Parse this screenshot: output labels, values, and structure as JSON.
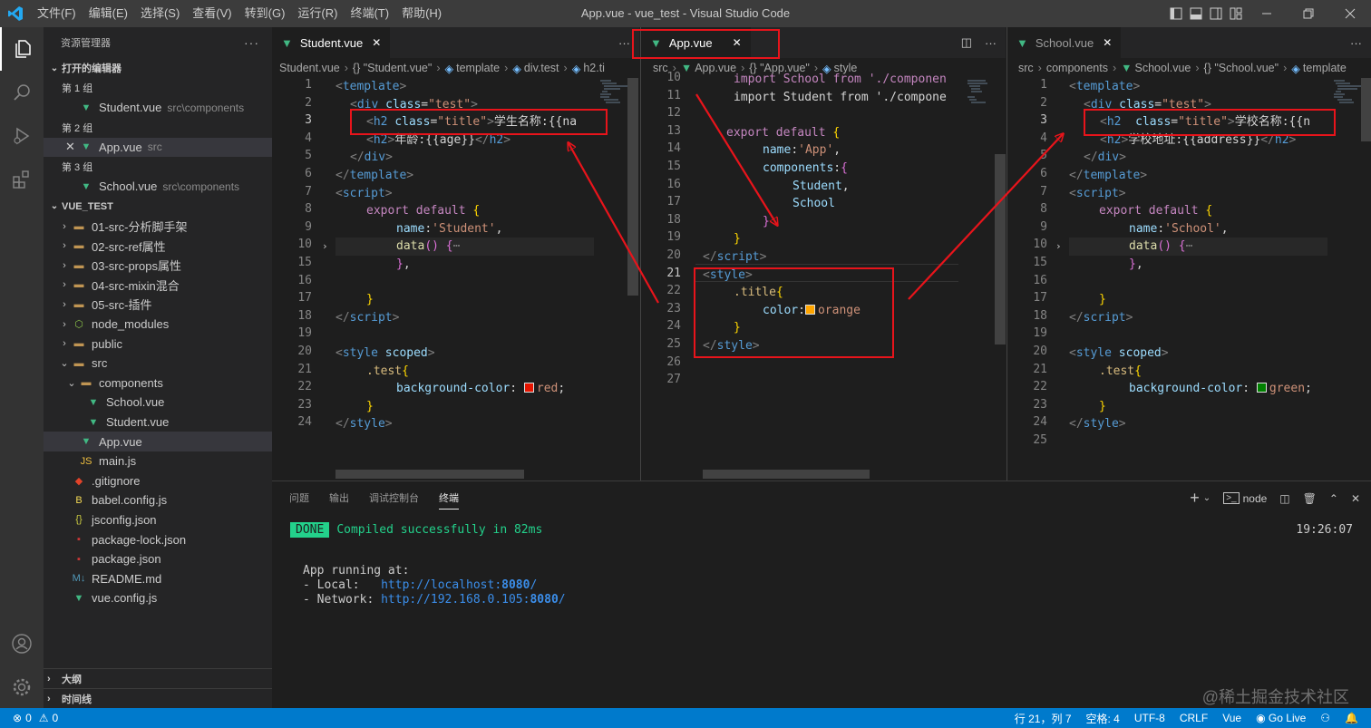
{
  "menu": [
    "文件(F)",
    "编辑(E)",
    "选择(S)",
    "查看(V)",
    "转到(G)",
    "运行(R)",
    "终端(T)",
    "帮助(H)"
  ],
  "window_title": "App.vue - vue_test - Visual Studio Code",
  "explorer": {
    "title": "资源管理器",
    "open_editors": "打开的编辑器",
    "groups": [
      {
        "label": "第 1 组",
        "file": "Student.vue",
        "path": "src\\components"
      },
      {
        "label": "第 2 组",
        "file": "App.vue",
        "path": "src"
      },
      {
        "label": "第 3 组",
        "file": "School.vue",
        "path": "src\\components"
      }
    ],
    "project": "VUE_TEST",
    "folders": [
      "01-src-分析脚手架",
      "02-src-ref属性",
      "03-src-props属性",
      "04-src-mixin混合",
      "05-src-插件",
      "node_modules",
      "public",
      "src"
    ],
    "components_folder": "components",
    "component_files": [
      "School.vue",
      "Student.vue"
    ],
    "src_files": [
      "App.vue",
      "main.js"
    ],
    "root_files": [
      ".gitignore",
      "babel.config.js",
      "jsconfig.json",
      "package-lock.json",
      "package.json",
      "README.md",
      "vue.config.js"
    ],
    "outline": "大纲",
    "timeline": "时间线"
  },
  "editor1": {
    "tab": "Student.vue",
    "crumbs": [
      "Student.vue",
      "{} \"Student.vue\"",
      "template",
      "div.test",
      "h2.ti"
    ],
    "line_numbers": [
      "1",
      "2",
      "3",
      "4",
      "5",
      "6",
      "7",
      "8",
      "9",
      "10",
      "15",
      "16",
      "17",
      "18",
      "19",
      "20",
      "21",
      "22",
      "23",
      "24"
    ]
  },
  "editor2": {
    "tab": "App.vue",
    "crumbs": [
      "src",
      "App.vue",
      "{} \"App.vue\"",
      "style"
    ],
    "line_numbers": [
      "10",
      "11",
      "12",
      "13",
      "14",
      "15",
      "16",
      "17",
      "18",
      "19",
      "20",
      "21",
      "22",
      "23",
      "24",
      "25",
      "26",
      "27"
    ]
  },
  "editor3": {
    "tab": "School.vue",
    "crumbs": [
      "src",
      "components",
      "School.vue",
      "{} \"School.vue\"",
      "template"
    ],
    "line_numbers": [
      "1",
      "2",
      "3",
      "4",
      "5",
      "6",
      "7",
      "8",
      "9",
      "10",
      "15",
      "16",
      "17",
      "18",
      "19",
      "20",
      "21",
      "22",
      "23",
      "24",
      "25"
    ]
  },
  "code": {
    "template_open": "template",
    "div": "div",
    "class_attr": "class",
    "test_val": "\"test\"",
    "title_val": "\"title\"",
    "h2": "h2",
    "student_name": "学生名称:{{na",
    "student_age": "年龄:{{age}}",
    "script": "script",
    "export": "export",
    "default": "default",
    "name_key": "name",
    "student_str": "'Student'",
    "data_fn": "data",
    "ellipsis": "⋯",
    "style": "style",
    "scoped": "scoped",
    "test_sel": ".test",
    "bg_prop": "background-color",
    "red": "red",
    "app_import1": "import School from './componen",
    "app_import2": "import Student from './compone",
    "app_str": "'App'",
    "components_key": "components",
    "student_ref": "Student",
    "school_ref": "School",
    "title_sel": ".title",
    "color_prop": "color",
    "orange": "orange",
    "school_name": "学校名称:{{n",
    "school_addr": "学校地址:{{address}}",
    "school_str": "'School'",
    "green": "green"
  },
  "panel": {
    "tabs": [
      "问题",
      "输出",
      "调试控制台",
      "终端"
    ],
    "terminal_name": "node",
    "done": "DONE",
    "compiled": "Compiled successfully in 82ms",
    "time": "19:26:07",
    "running": "App running at:",
    "local_label": "- Local:   ",
    "local_url_a": "http://localhost:",
    "local_url_b": "8080",
    "local_url_c": "/",
    "network_label": "- Network: ",
    "network_url_a": "http://192.168.0.105:",
    "network_url_b": "8080",
    "network_url_c": "/"
  },
  "status": {
    "errors": "0",
    "warnings": "0",
    "position": "行 21，列 7",
    "spaces": "空格: 4",
    "encoding": "UTF-8",
    "eol": "CRLF",
    "language": "Vue",
    "golive": "Go Live"
  },
  "watermark": "@稀土掘金技术社区",
  "colors": {
    "accent": "#007acc",
    "highlight_box": "#e8141b",
    "red": "#e51400",
    "orange": "#ffa500",
    "green": "#008000"
  }
}
